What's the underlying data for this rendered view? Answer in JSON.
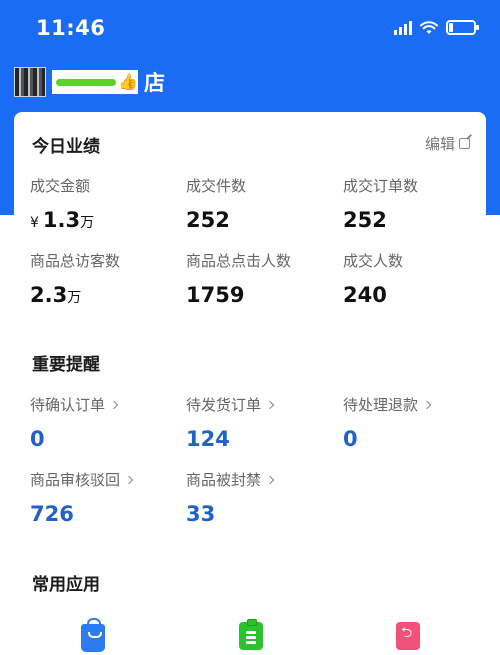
{
  "status_bar": {
    "time": "11:46"
  },
  "store": {
    "name_suffix": "店"
  },
  "today": {
    "title": "今日业绩",
    "edit_label": "编辑",
    "metrics": [
      {
        "label": "成交金额",
        "currency": "¥",
        "value": "1.3",
        "unit": "万"
      },
      {
        "label": "成交件数",
        "value": "252"
      },
      {
        "label": "成交订单数",
        "value": "252"
      },
      {
        "label": "商品总访客数",
        "value": "2.3",
        "unit": "万"
      },
      {
        "label": "商品总点击人数",
        "value": "1759"
      },
      {
        "label": "成交人数",
        "value": "240"
      }
    ]
  },
  "reminders": {
    "title": "重要提醒",
    "items": [
      {
        "label": "待确认订单",
        "value": "0"
      },
      {
        "label": "待发货订单",
        "value": "124"
      },
      {
        "label": "待处理退款",
        "value": "0"
      },
      {
        "label": "商品审核驳回",
        "value": "726"
      },
      {
        "label": "商品被封禁",
        "value": "33"
      }
    ]
  },
  "apps": {
    "title": "常用应用",
    "icons": [
      "shopping-bag-icon",
      "clipboard-list-icon",
      "return-icon"
    ]
  },
  "colors": {
    "header_blue": "#1a6cf5",
    "link_blue": "#2161c9"
  }
}
